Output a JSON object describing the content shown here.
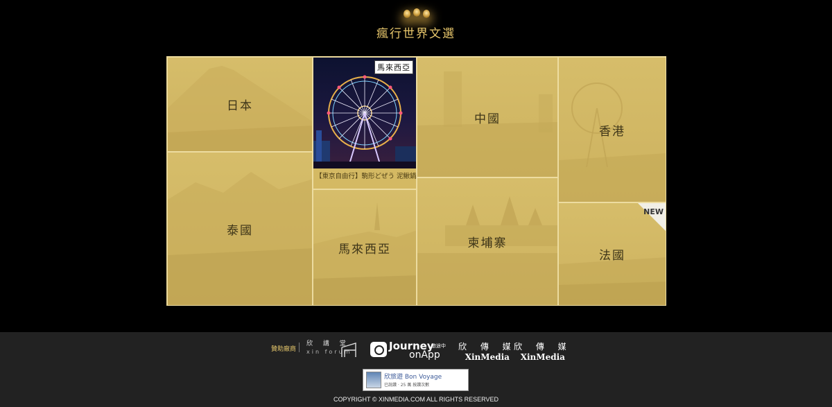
{
  "header": {
    "title": "瘋行世界文選"
  },
  "grid": {
    "tiles": [
      {
        "label": "日本"
      },
      {
        "label": "泰國"
      },
      {
        "label": "馬來西亞"
      },
      {
        "label": "中國"
      },
      {
        "label": "柬埔寨"
      },
      {
        "label": "香港"
      },
      {
        "label": "法國"
      }
    ],
    "feature": {
      "tag": "馬來西亞",
      "caption": "【東京自由行】駒形どぜう 泥鰍鍋"
    },
    "new_badge": "NEW"
  },
  "footer": {
    "sponsor_label": "贊助廠商",
    "xin_forum_zh": "欣 講 堂",
    "xin_forum_en": "xin forum",
    "journey_main": "Journey",
    "journey_sub": "旅途中",
    "journey_on": "onApp",
    "xinmedia_zh": "欣 傳 媒",
    "xinmedia_en": "XinMedia",
    "fb_name": "欣旅遊 Bon Voyage",
    "fb_stats": "已說讚 · 25 萬 按讚次數",
    "copyright": "COPYRIGHT © XINMEDIA.COM ALL RIGHTS RESERVED"
  }
}
